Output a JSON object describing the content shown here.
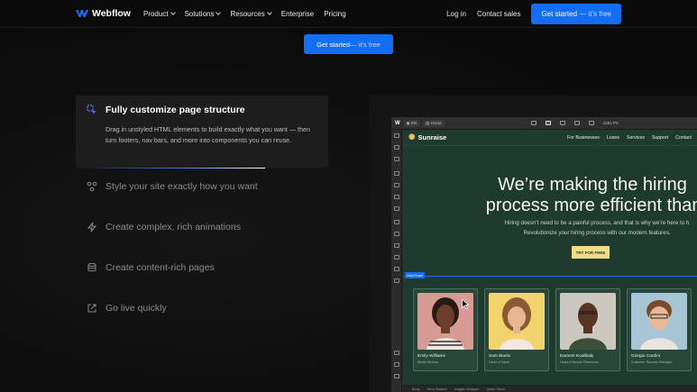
{
  "nav": {
    "brand": "Webflow",
    "items": [
      {
        "label": "Product",
        "has_menu": true
      },
      {
        "label": "Solutions",
        "has_menu": true
      },
      {
        "label": "Resources",
        "has_menu": true
      },
      {
        "label": "Enterprise",
        "has_menu": false
      },
      {
        "label": "Pricing",
        "has_menu": false
      }
    ],
    "login": "Log in",
    "contact": "Contact sales",
    "cta": "Get started",
    "cta_suffix": " — it's free"
  },
  "hero": {
    "cta": "Get started",
    "cta_suffix": " — it's free"
  },
  "features": {
    "active": {
      "title": "Fully customize page structure",
      "description": "Drag in unstyled HTML elements to build exactly what you want — then turn footers, nav bars, and more into components you can reuse.",
      "progress": 0.75
    },
    "items": [
      {
        "label": "Style your site exactly how you want",
        "icon": "style-icon"
      },
      {
        "label": "Create complex, rich animations",
        "icon": "lightning-icon"
      },
      {
        "label": "Create content-rich pages",
        "icon": "database-icon"
      },
      {
        "label": "Go live quickly",
        "icon": "external-link-icon"
      }
    ]
  },
  "designer": {
    "locale": "EN",
    "page": "Home",
    "breakpoint": "1281 PX",
    "site": {
      "brand": "Sunraise",
      "links": [
        "For Businesses",
        "Loans",
        "Services",
        "Support",
        "Contact"
      ],
      "headline_1": "We’re making the hiring",
      "headline_2": "process more efficient than e",
      "paragraph_1": "Hiring doesn’t need to be a painful process, and that is why we’re here to h",
      "paragraph_2": "Revolutionize your hiring process with our modern features.",
      "cta": "TRY FOR FREE",
      "selection_tag": "Grid Team",
      "cards": [
        {
          "name": "Emily Williams",
          "role": "Media Director"
        },
        {
          "name": "Sam Ibarra",
          "role": "Head of Talent"
        },
        {
          "name": "Earnest Koulibaly",
          "role": "Head of Human Resources"
        },
        {
          "name": "Giorgio Cardini",
          "role": "Customer Success Manager"
        }
      ]
    },
    "breadcrumbs": [
      "Body",
      "Hero Section",
      "Images Wrapper",
      "Quick Stack"
    ]
  },
  "colors": {
    "accent": "#146ef5",
    "site_bg": "#1f3a2e",
    "site_cta": "#f2dc86"
  }
}
